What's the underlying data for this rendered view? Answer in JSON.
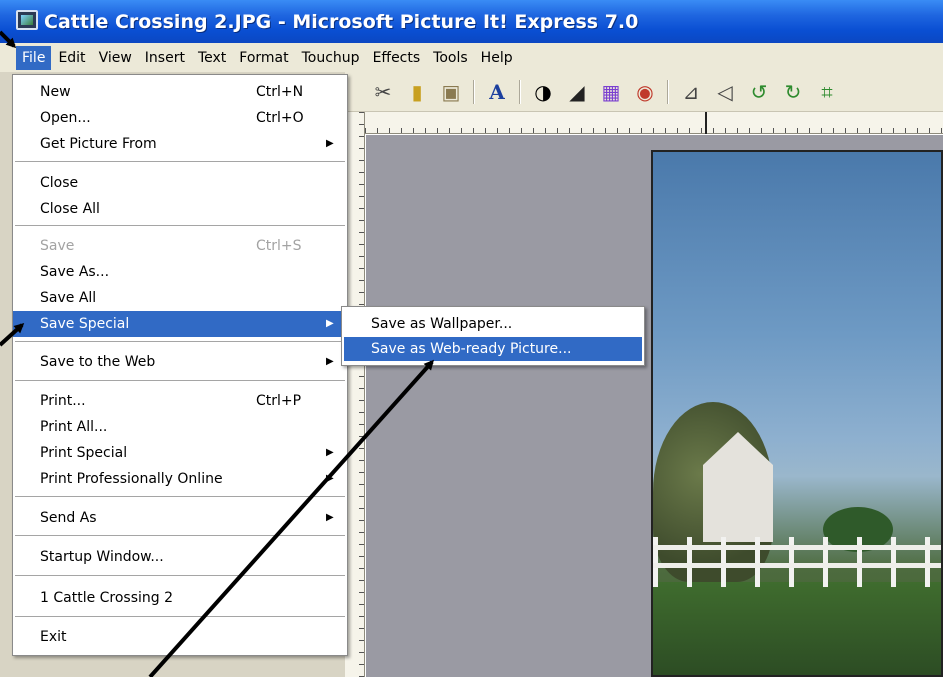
{
  "window": {
    "title": "Cattle Crossing 2.JPG - Microsoft Picture It! Express 7.0"
  },
  "menubar": {
    "items": [
      "File",
      "Edit",
      "View",
      "Insert",
      "Text",
      "Format",
      "Touchup",
      "Effects",
      "Tools",
      "Help"
    ],
    "active": "File"
  },
  "file_menu": {
    "items": [
      {
        "label": "New",
        "shortcut": "Ctrl+N"
      },
      {
        "label": "Open...",
        "shortcut": "Ctrl+O"
      },
      {
        "label": "Get Picture From",
        "submenu": true
      },
      {
        "label": "Close"
      },
      {
        "label": "Close All"
      },
      {
        "label": "Save",
        "shortcut": "Ctrl+S",
        "disabled": true
      },
      {
        "label": "Save As..."
      },
      {
        "label": "Save All"
      },
      {
        "label": "Save Special",
        "submenu": true,
        "highlighted": true
      },
      {
        "label": "Save to the Web",
        "submenu": true
      },
      {
        "label": "Print...",
        "shortcut": "Ctrl+P"
      },
      {
        "label": "Print All..."
      },
      {
        "label": "Print Special",
        "submenu": true
      },
      {
        "label": "Print Professionally Online",
        "submenu": true
      },
      {
        "label": "Send As",
        "submenu": true
      },
      {
        "label": "Startup Window..."
      },
      {
        "label": "1 Cattle Crossing 2"
      },
      {
        "label": "Exit"
      }
    ]
  },
  "save_special_submenu": {
    "items": [
      {
        "label": "Save as Wallpaper..."
      },
      {
        "label": "Save as Web-ready Picture...",
        "highlighted": true
      }
    ]
  },
  "toolbar": {
    "icons": [
      "cut-icon",
      "copy-icon",
      "paste-icon",
      "text-icon",
      "contrast-icon",
      "brightness-icon",
      "color-icon",
      "red-eye-icon",
      "flip-icon",
      "rotate-icon",
      "rotate-left-icon",
      "rotate-right-icon",
      "crop-icon"
    ]
  },
  "colors": {
    "titlebar": "#0a4fd3",
    "menu_highlight": "#316ac5",
    "menubar_bg": "#ece9d8",
    "canvas_bg": "#9a9aa3"
  }
}
